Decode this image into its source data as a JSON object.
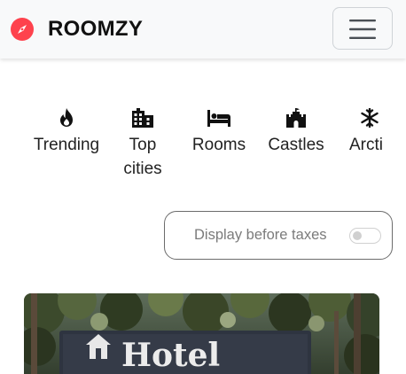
{
  "navbar": {
    "brand": "ROOMZY",
    "brand_icon": "compass-icon",
    "brand_color": "#fe424d",
    "menu_icon": "hamburger-icon"
  },
  "categories": [
    {
      "label": "Trending",
      "icon": "fire-icon"
    },
    {
      "label": "Top cities",
      "icon": "city-icon"
    },
    {
      "label": "Rooms",
      "icon": "bed-icon"
    },
    {
      "label": "Castles",
      "icon": "castle-icon"
    },
    {
      "label": "Arcti",
      "icon": "snowflake-icon"
    }
  ],
  "tax_toggle": {
    "label": "Display before taxes",
    "checked": false
  },
  "listing": {
    "sign_text": "Hotel",
    "image_icon": "house-icon"
  }
}
